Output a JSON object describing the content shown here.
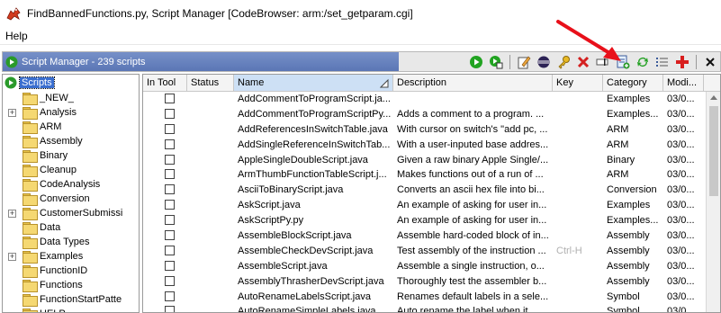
{
  "window": {
    "title": "FindBannedFunctions.py, Script Manager [CodeBrowser: arm:/set_getparam.cgi]"
  },
  "menubar": {
    "items": [
      {
        "label": "Help"
      }
    ]
  },
  "panel": {
    "title": "Script Manager - 239 scripts",
    "toolbar": [
      {
        "icon": "run-script-icon"
      },
      {
        "icon": "run-last-script-icon"
      },
      {
        "icon": "edit-script-icon"
      },
      {
        "icon": "eclipse-icon"
      },
      {
        "icon": "key-binding-icon"
      },
      {
        "icon": "delete-script-icon"
      },
      {
        "icon": "rename-script-icon"
      },
      {
        "icon": "new-script-icon"
      },
      {
        "icon": "refresh-icon"
      },
      {
        "icon": "script-directories-icon"
      },
      {
        "icon": "help-icon"
      },
      {
        "icon": "close-icon"
      }
    ]
  },
  "tree": {
    "root": "Scripts",
    "items": [
      {
        "label": "_NEW_",
        "expandable": false
      },
      {
        "label": "Analysis",
        "expandable": true
      },
      {
        "label": "ARM",
        "expandable": false
      },
      {
        "label": "Assembly",
        "expandable": false
      },
      {
        "label": "Binary",
        "expandable": false
      },
      {
        "label": "Cleanup",
        "expandable": false
      },
      {
        "label": "CodeAnalysis",
        "expandable": false
      },
      {
        "label": "Conversion",
        "expandable": false
      },
      {
        "label": "CustomerSubmissi",
        "expandable": true
      },
      {
        "label": "Data",
        "expandable": false
      },
      {
        "label": "Data Types",
        "expandable": false
      },
      {
        "label": "Examples",
        "expandable": true
      },
      {
        "label": "FunctionID",
        "expandable": false
      },
      {
        "label": "Functions",
        "expandable": false
      },
      {
        "label": "FunctionStartPatte",
        "expandable": false
      },
      {
        "label": "HELP",
        "expandable": false
      }
    ]
  },
  "table": {
    "columns": [
      "In Tool",
      "Status",
      "Name",
      "Description",
      "Key",
      "Category",
      "Modi..."
    ],
    "rows": [
      {
        "name": "AddCommentToProgramScript.ja...",
        "description": "",
        "key": "",
        "category": "Examples",
        "modified": "03/0..."
      },
      {
        "name": "AddCommentToProgramScriptPy...",
        "description": "Adds a comment to a program. ...",
        "key": "",
        "category": "Examples...",
        "modified": "03/0..."
      },
      {
        "name": "AddReferencesInSwitchTable.java",
        "description": "With cursor on switch's \"add pc, ...",
        "key": "",
        "category": "ARM",
        "modified": "03/0..."
      },
      {
        "name": "AddSingleReferenceInSwitchTab...",
        "description": "With a user-inputed base addres...",
        "key": "",
        "category": "ARM",
        "modified": "03/0..."
      },
      {
        "name": "AppleSingleDoubleScript.java",
        "description": "Given a raw binary Apple Single/...",
        "key": "",
        "category": "Binary",
        "modified": "03/0..."
      },
      {
        "name": "ArmThumbFunctionTableScript.j...",
        "description": "Makes functions out of a run of ...",
        "key": "",
        "category": "ARM",
        "modified": "03/0..."
      },
      {
        "name": "AsciiToBinaryScript.java",
        "description": "Converts an ascii hex file into bi...",
        "key": "",
        "category": "Conversion",
        "modified": "03/0..."
      },
      {
        "name": "AskScript.java",
        "description": "An example of asking for user in...",
        "key": "",
        "category": "Examples",
        "modified": "03/0..."
      },
      {
        "name": "AskScriptPy.py",
        "description": "An example of asking for user in...",
        "key": "",
        "category": "Examples...",
        "modified": "03/0..."
      },
      {
        "name": "AssembleBlockScript.java",
        "description": "Assemble hard-coded block of in...",
        "key": "",
        "category": "Assembly",
        "modified": "03/0..."
      },
      {
        "name": "AssembleCheckDevScript.java",
        "description": "Test assembly of the instruction ...",
        "key": "Ctrl-H",
        "category": "Assembly",
        "modified": "03/0..."
      },
      {
        "name": "AssembleScript.java",
        "description": "Assemble a single instruction, o...",
        "key": "",
        "category": "Assembly",
        "modified": "03/0..."
      },
      {
        "name": "AssemblyThrasherDevScript.java",
        "description": "Thoroughly test the assembler b...",
        "key": "",
        "category": "Assembly",
        "modified": "03/0..."
      },
      {
        "name": "AutoRenameLabelsScript.java",
        "description": "Renames default labels in a sele...",
        "key": "",
        "category": "Symbol",
        "modified": "03/0..."
      },
      {
        "name": "AutoRenameSimpleLabels.java",
        "description": "Auto rename the label when it...",
        "key": "",
        "category": "Symbol",
        "modified": "03/0..."
      }
    ]
  },
  "colors": {
    "panel_title_bg": "#5b76b5",
    "selection_bg": "#3a6ecf",
    "annotation_arrow": "#e8101a"
  }
}
